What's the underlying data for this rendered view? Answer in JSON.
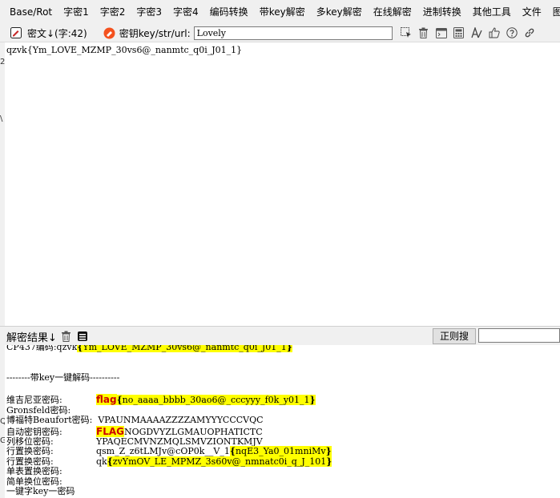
{
  "menu": [
    "Base/Rot",
    "字密1",
    "字密2",
    "字密3",
    "字密4",
    "编码转换",
    "带key解密",
    "多key解密",
    "在线解密",
    "进制转换",
    "其他工具",
    "文件",
    "图"
  ],
  "toolbar": {
    "cipher_label": "密文↓(字:42)",
    "key_label": "密钥key/str/url:",
    "key_value": "Lovely"
  },
  "input_text": "qzvk{Ym_LOVE_MZMP_30vs6@_nanmtc_q0i_J01_1}",
  "side_fragments": [
    "2",
    "\\",
    "Q",
    "G"
  ],
  "result_label": "解密结果↓",
  "regex_button": "正则搜",
  "output": {
    "cp437_label": "CP437编码:",
    "cp437_pre": "qzvk",
    "cp437_mid": "Ym_LOVE_MZMP_30vs6@_nanmtc_q0i_J01_1",
    "section_header": "--------带key一键解码----------",
    "vigenere_label": "维吉尼亚密码:",
    "vigenere_flag": "flag",
    "vigenere_mid": "no_aaaa_bbbb_30ao6@_cccyyy_f0k_y01_1",
    "gronsfeld_label": "Gronsfeld密码:",
    "beaufort_label": "博福特Beaufort密码:",
    "beaufort_value": "VPAUNMAAAAZZZZAMYYYCCCVQC",
    "autokey_label": "自动密钥密码:",
    "autokey_flag": "FLAG",
    "autokey_value": "NOGDVYZLGMAUOPHATICTC",
    "columnar_label": "列移位密码:",
    "columnar_value": "YPAQECMVNZMQLSMVZIONTKMJV",
    "row_label": "行置换密码:",
    "row_pre": "qsm_Z_z6tLMJv@cOP0k__V_1",
    "row_mid": "nqE3_Ya0_01mniMv",
    "col2_label": "行置换密码:",
    "col2_pre": "qk",
    "col2_mid": "zvYmOV_LE_MPMZ_3s60v@_nmnatc0i_q_J_101",
    "simple_sub_label": "单表置换密码:",
    "simple_shift_label": "简单换位密码:",
    "last_line": "一键字key一密码"
  },
  "colors": {
    "highlight": "#ffff00",
    "flag_red": "#cc0000",
    "chrome": "#f0f0f0"
  }
}
